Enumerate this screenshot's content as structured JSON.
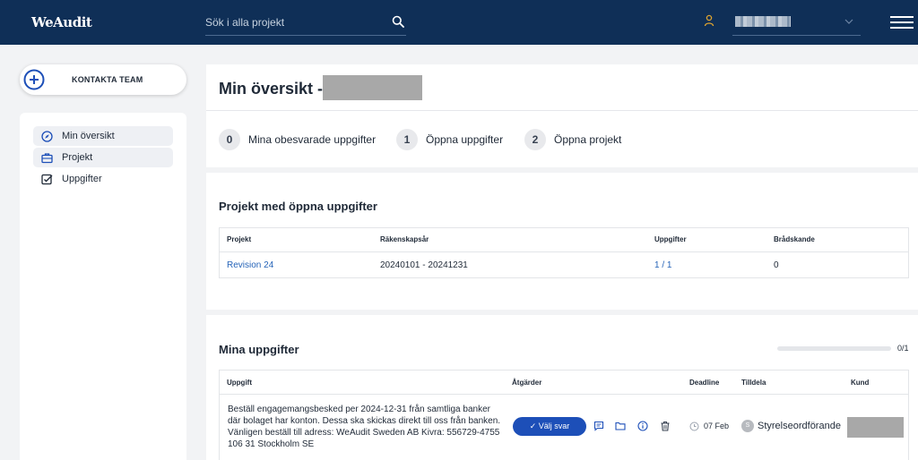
{
  "header": {
    "logo": "WeAudit",
    "search_placeholder": "Sök i alla projekt"
  },
  "contact": {
    "label": "KONTAKTA TEAM"
  },
  "sidebar": {
    "items": [
      {
        "label": "Min översikt"
      },
      {
        "label": "Projekt"
      },
      {
        "label": "Uppgifter"
      }
    ]
  },
  "overview": {
    "title": "Min översikt -"
  },
  "stats": [
    {
      "count": "0",
      "label": "Mina obesvarade uppgifter"
    },
    {
      "count": "1",
      "label": "Öppna uppgifter"
    },
    {
      "count": "2",
      "label": "Öppna projekt"
    }
  ],
  "projects": {
    "title": "Projekt med öppna uppgifter",
    "columns": [
      "Projekt",
      "Räkenskapsår",
      "Uppgifter",
      "Brådskande"
    ],
    "rows": [
      {
        "projekt": "Revision 24",
        "period": "20240101 - 20241231",
        "uppgifter": "1 / 1",
        "bradskande": "0"
      }
    ]
  },
  "tasks": {
    "title": "Mina uppgifter",
    "progress": {
      "done": 0,
      "total": 1,
      "label": "0/1"
    },
    "columns": [
      "Uppgift",
      "Åtgärder",
      "Deadline",
      "Tilldela",
      "Kund"
    ],
    "rows": [
      {
        "text": "Beställ engagemangsbesked per 2024-12-31 från samtliga banker där bolaget har konton. Dessa ska skickas direkt till oss från banken. Vänligen beställ till adress: WeAudit Sweden AB Kivra: 556729-4755 106 31 Stockholm SE",
        "action_label": "✓ Välj svar",
        "deadline": "07 Feb",
        "assignee_initial": "S",
        "assignee": "Styrelseordförande"
      }
    ]
  },
  "colors": {
    "topbar": "#0f2f57",
    "accent": "#1d4fb8",
    "link": "#2563b8"
  }
}
